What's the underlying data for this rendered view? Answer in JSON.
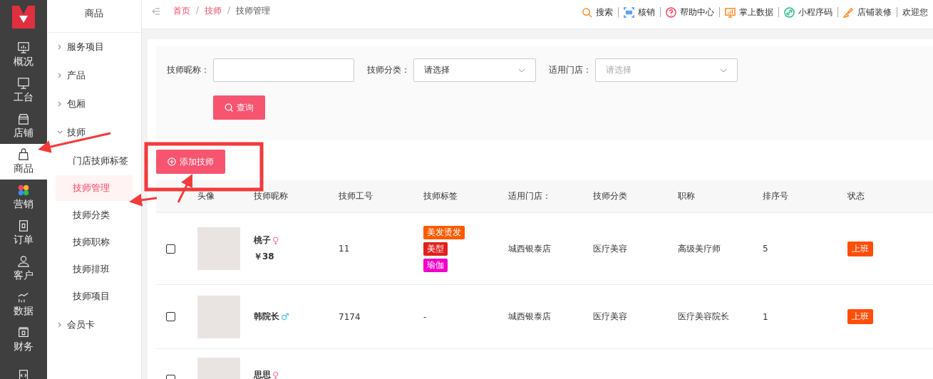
{
  "rail": {
    "items": [
      {
        "label": "概况",
        "selected": false
      },
      {
        "label": "工台",
        "selected": false
      },
      {
        "label": "店铺",
        "selected": false
      },
      {
        "label": "商品",
        "selected": true
      },
      {
        "label": "营销",
        "selected": false
      },
      {
        "label": "订单",
        "selected": false
      },
      {
        "label": "客户",
        "selected": false
      },
      {
        "label": "数据",
        "selected": false
      },
      {
        "label": "财务",
        "selected": false
      },
      {
        "selected": false
      }
    ]
  },
  "submenu": {
    "title": "商品",
    "items": [
      {
        "label": "服务项目",
        "expanded": false
      },
      {
        "label": "产品",
        "expanded": false
      },
      {
        "label": "包厢",
        "expanded": false
      },
      {
        "label": "技师",
        "expanded": true,
        "children": [
          {
            "label": "门店技师标签",
            "selected": false
          },
          {
            "label": "技师管理",
            "selected": true
          },
          {
            "label": "技师分类",
            "selected": false
          },
          {
            "label": "技师职称",
            "selected": false
          },
          {
            "label": "技师排班",
            "selected": false
          },
          {
            "label": "技师项目",
            "selected": false
          }
        ]
      },
      {
        "label": "会员卡",
        "expanded": false
      }
    ]
  },
  "breadcrumb": [
    {
      "kind": "link",
      "label": "首页",
      "selected": false
    },
    {
      "kind": "separator",
      "label": "/"
    },
    {
      "kind": "link",
      "label": "技师",
      "selected": false
    },
    {
      "kind": "separator",
      "label": "/"
    },
    {
      "kind": "link",
      "label": "技师管理",
      "selected": true
    }
  ],
  "toolbar": [
    "搜索",
    "核销",
    "帮助中心",
    "掌上数据",
    "小程序码",
    "店铺装修",
    "欢迎您"
  ],
  "filters": [
    {
      "label": "技师昵称：",
      "kind": "text"
    },
    {
      "label": "技师分类：",
      "kind": "select",
      "value": "请选择"
    },
    {
      "label": "适用门店：",
      "kind": "select",
      "placeholder": "请选择"
    }
  ],
  "query_button": "查询",
  "add_button": "添加技师",
  "table": {
    "columns": [
      "头像",
      "技师昵称",
      "技师工号",
      "技师标签",
      "适用门店：",
      "技师分类",
      "职称",
      "排序号",
      "状态"
    ],
    "rows": [
      {
        "checked": false,
        "name": "桃子",
        "gender": {
          "symbol": "♀",
          "color": "#f776a0"
        },
        "price": "￥38",
        "work_no": "11",
        "tags": [
          {
            "label": "美发烫发",
            "color": "#ff5a00"
          },
          {
            "label": "美型",
            "color": "#e0201c"
          },
          {
            "label": "瑜伽",
            "color": "#f000c8"
          }
        ],
        "store": "城西银泰店",
        "category": "医疗美容",
        "title": "高级美疗师",
        "sort": "5",
        "status": "上班"
      },
      {
        "checked": false,
        "name": "韩院长",
        "gender": {
          "symbol": "♂",
          "color": "#3ec0f0"
        },
        "work_no": "7174",
        "tags_text": "-",
        "store": "城西银泰店",
        "category": "医疗美容",
        "title": "医疗美容院长",
        "sort": "1",
        "status": "上班"
      },
      {
        "checked": false,
        "name": "思思",
        "gender": {
          "symbol": "♀",
          "color": "#f776a0"
        }
      }
    ]
  }
}
